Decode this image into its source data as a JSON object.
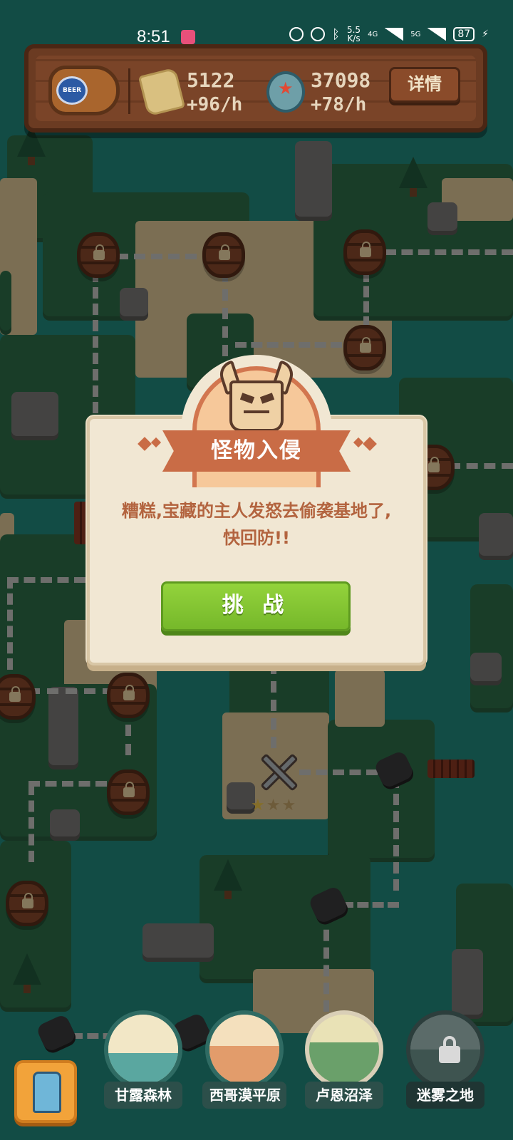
{
  "status_bar": {
    "time": "8:51",
    "speed_value": "5.5",
    "speed_unit": "K/s",
    "network_1": "4G",
    "network_2": "5G",
    "battery": "87"
  },
  "resources": {
    "keg_label": "BEER",
    "chips_amount": "5122",
    "chips_rate": "+96/h",
    "caps_amount": "37098",
    "caps_rate": "+78/h",
    "details_label": "详情"
  },
  "modal": {
    "title": "怪物入侵",
    "message_line1": "糟糕,宝藏的主人发怒去偷袭基地了,",
    "message_line2": "快回防!!",
    "challenge_label": "挑 战"
  },
  "level_node": {
    "stars_earned": 1,
    "stars_total": 3
  },
  "regions": [
    {
      "label": "甘露森林",
      "locked": false
    },
    {
      "label": "西哥漠平原",
      "locked": false
    },
    {
      "label": "卢恩沼泽",
      "locked": false
    },
    {
      "label": "迷雾之地",
      "locked": true
    }
  ],
  "colors": {
    "accent": "#c96c46",
    "challenge_button": "#84c533",
    "sea": "#228a7e",
    "land": "#2f6f49",
    "wood": "#6b3b22"
  },
  "icons": [
    "eye-icon",
    "alarm-icon",
    "bluetooth-icon",
    "signal-icon",
    "battery-icon",
    "beer-keg-icon",
    "chips-icon",
    "bottle-cap-icon",
    "monster-icon",
    "crossed-swords-icon",
    "lock-icon",
    "knight-icon"
  ]
}
